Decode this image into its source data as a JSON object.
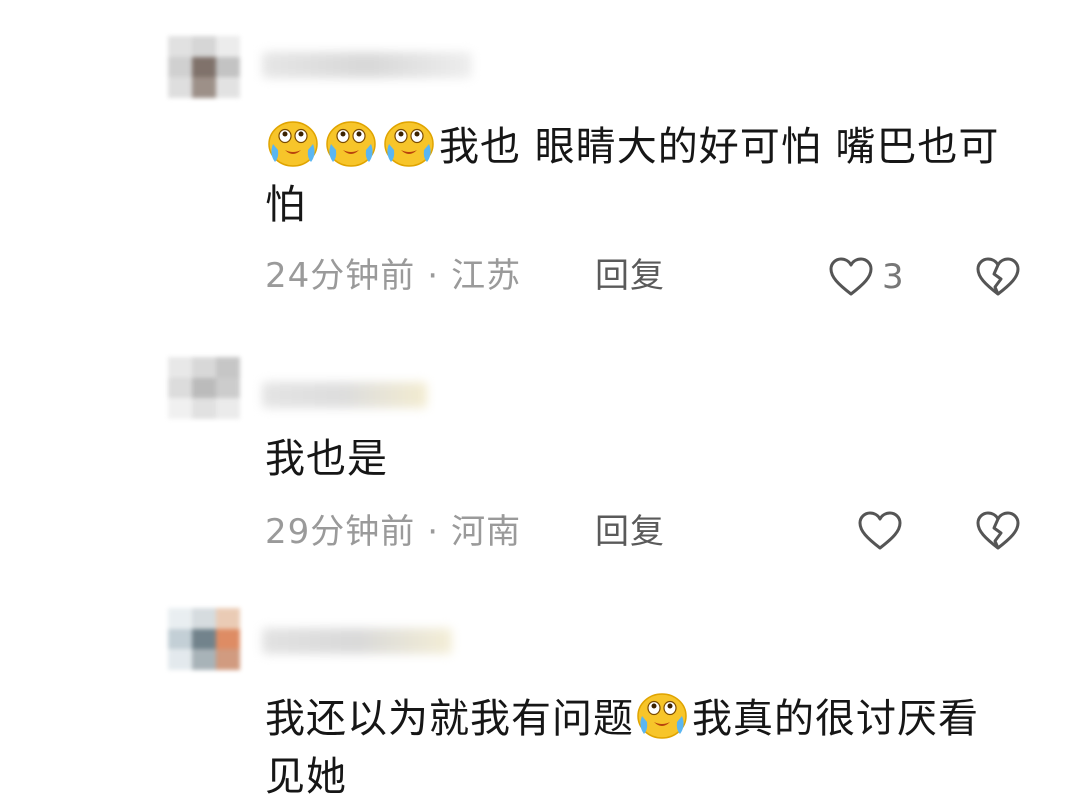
{
  "comments": [
    {
      "text_prefix_emojis": 3,
      "text": "我也 眼睛大的好可怕 嘴巴也可怕",
      "time": "24分钟前",
      "location": "江苏",
      "reply_label": "回复",
      "like_count": "3"
    },
    {
      "text": "我也是",
      "time": "29分钟前",
      "location": "河南",
      "reply_label": "回复",
      "like_count": ""
    },
    {
      "text_part1": "我还以为就我有问题",
      "text_part2": "我真的很讨厌看见她"
    }
  ],
  "icons": {
    "like": "heart-outline-icon",
    "dislike": "broken-heart-icon",
    "emoji": "crying-laughing-emoji"
  },
  "colors": {
    "meta_text": "#9a9a9a",
    "reply_text": "#5a5a5a",
    "body_text": "#161616"
  }
}
